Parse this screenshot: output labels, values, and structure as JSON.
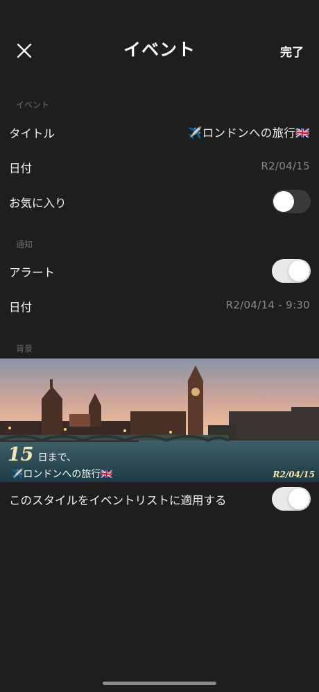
{
  "nav": {
    "title": "イベント",
    "done_label": "完了"
  },
  "event_section": {
    "header": "イベント",
    "title_label": "タイトル",
    "title_value": "✈️ロンドンへの旅行🇬🇧",
    "date_label": "日付",
    "date_value": "R2/04/15",
    "favorite_label": "お気に入り",
    "favorite_on": false
  },
  "notification_section": {
    "header": "通知",
    "alert_label": "アラート",
    "alert_on": true,
    "date_label": "日付",
    "date_value": "R2/04/14 - 9:30"
  },
  "background_section": {
    "header": "背景",
    "overlay_days": "15",
    "overlay_suffix": "日まで、",
    "overlay_title": "✈️ロンドンへの旅行🇬🇧",
    "overlay_date": "R2/04/15",
    "apply_label": "このスタイルをイベントリストに適用する",
    "apply_on": true
  },
  "icons": {
    "close": "close-icon"
  },
  "colors": {
    "background": "#1e1e1e",
    "accent_text": "#f6e7b8",
    "secondary_text": "#8a8a8a"
  }
}
